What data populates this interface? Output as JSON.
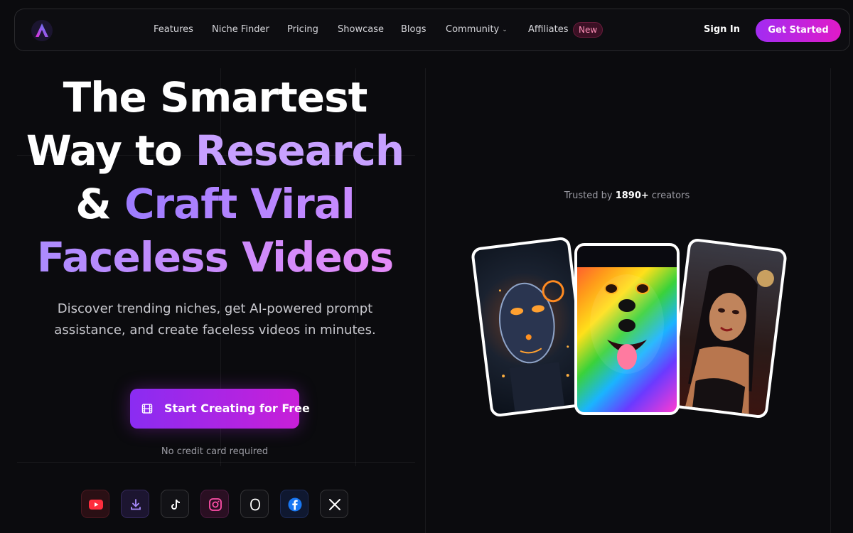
{
  "nav": {
    "logo_icon": "logo-icon",
    "links": [
      "Features",
      "Niche Finder",
      "Pricing",
      "Showcase",
      "Blogs",
      "Community",
      "Affiliates"
    ],
    "new_badge": "New",
    "sign_in": "Sign In",
    "get_started": "Get Started"
  },
  "hero": {
    "title_line1": "The Smartest",
    "title_line2a": "Way to ",
    "title_line2b": "Research",
    "title_line3a": "& ",
    "title_line3b": "Craft Viral",
    "title_line4": "Faceless Videos",
    "subtitle": "Discover trending niches, get AI-powered prompt assistance, and create faceless videos in minutes.",
    "cta_label": "Start Creating for Free",
    "cta_icon": "film-icon",
    "no_credit": "No credit card required"
  },
  "socials": [
    "youtube-icon",
    "download-icon",
    "tiktok-icon",
    "instagram-icon",
    "threads-icon",
    "facebook-icon",
    "x-icon"
  ],
  "trusted": {
    "prefix": "Trusted by",
    "count": "1890+",
    "suffix": "creators"
  },
  "showcase_cards": [
    "robot-face-image",
    "rainbow-dog-image",
    "gothic-woman-image"
  ],
  "colors": {
    "background": "#0b0b0e",
    "accent_start": "#8a2cf2",
    "accent_end": "#e01ac8",
    "gradient_text": "#c7a0ff"
  }
}
